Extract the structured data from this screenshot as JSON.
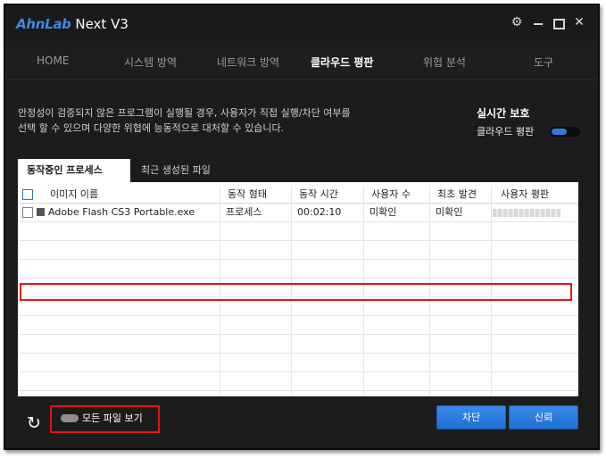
{
  "window": {
    "title_brand": "AhnLab",
    "title_rest": " Next V3",
    "controls": {
      "settings_icon": "gear-icon",
      "minimize_icon": "minimize-icon",
      "maximize_icon": "maximize-icon",
      "close_icon": "close-icon"
    }
  },
  "nav": {
    "items": [
      {
        "label": "HOME"
      },
      {
        "label": "시스템 방역"
      },
      {
        "label": "네트워크 방역"
      },
      {
        "label": "클라우드 평판"
      },
      {
        "label": "위협 분석"
      },
      {
        "label": "도구"
      }
    ],
    "active": "클라우드 평판"
  },
  "description": {
    "line1": "안정성이 검증되지 않은 프로그램이 실행될 경우, 사용자가 직접 실행/차단 여부를",
    "line2": "선택 할 수 있으며 다양한 위협에 능동적으로 대처할 수 있습니다."
  },
  "realtime": {
    "title": "실시간 보호",
    "label": "클라우드 평판",
    "enabled": true,
    "accent": "#2f7be0"
  },
  "tabs": [
    {
      "label": "동작중인 프로세스",
      "active": true
    },
    {
      "label": "최근 생성된 파일",
      "active": false
    }
  ],
  "table": {
    "columns": [
      "이미지 이름",
      "동작 형태",
      "동작 시간",
      "사용자 수",
      "최초 발견",
      "사용자 평판"
    ],
    "rows": [
      {
        "name": "Adobe Flash CS3 Portable.exe",
        "type": "프로세스",
        "time": "00:02:10",
        "users": "미확인",
        "first_seen": "미확인",
        "reputation": "",
        "checked": false
      }
    ]
  },
  "footer": {
    "refresh_icon": "refresh-icon",
    "show_all_label": "모든 파일 보기",
    "show_all_enabled": false,
    "block_label": "차단",
    "trust_label": "신뢰"
  },
  "colors": {
    "highlight": "#e21414",
    "button": "#2b7de0",
    "background": "#1e1e1e"
  }
}
